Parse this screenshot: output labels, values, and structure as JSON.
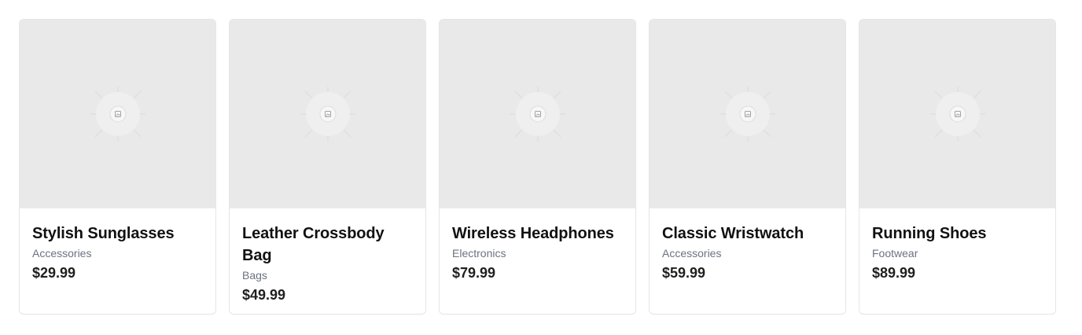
{
  "products": [
    {
      "title": "Stylish Sunglasses",
      "category": "Accessories",
      "price": "$29.99",
      "image_icon": "image-placeholder-icon"
    },
    {
      "title": "Leather Crossbody Bag",
      "category": "Bags",
      "price": "$49.99",
      "image_icon": "image-placeholder-icon"
    },
    {
      "title": "Wireless Headphones",
      "category": "Electronics",
      "price": "$79.99",
      "image_icon": "image-placeholder-icon"
    },
    {
      "title": "Classic Wristwatch",
      "category": "Accessories",
      "price": "$59.99",
      "image_icon": "image-placeholder-icon"
    },
    {
      "title": "Running Shoes",
      "category": "Footwear",
      "price": "$89.99",
      "image_icon": "image-placeholder-icon"
    }
  ],
  "colors": {
    "image_background": "#e9e9e9",
    "card_border": "#e5e5e5",
    "title_text": "#111111",
    "category_text": "#6b7280",
    "price_text": "#1f1f1f"
  }
}
